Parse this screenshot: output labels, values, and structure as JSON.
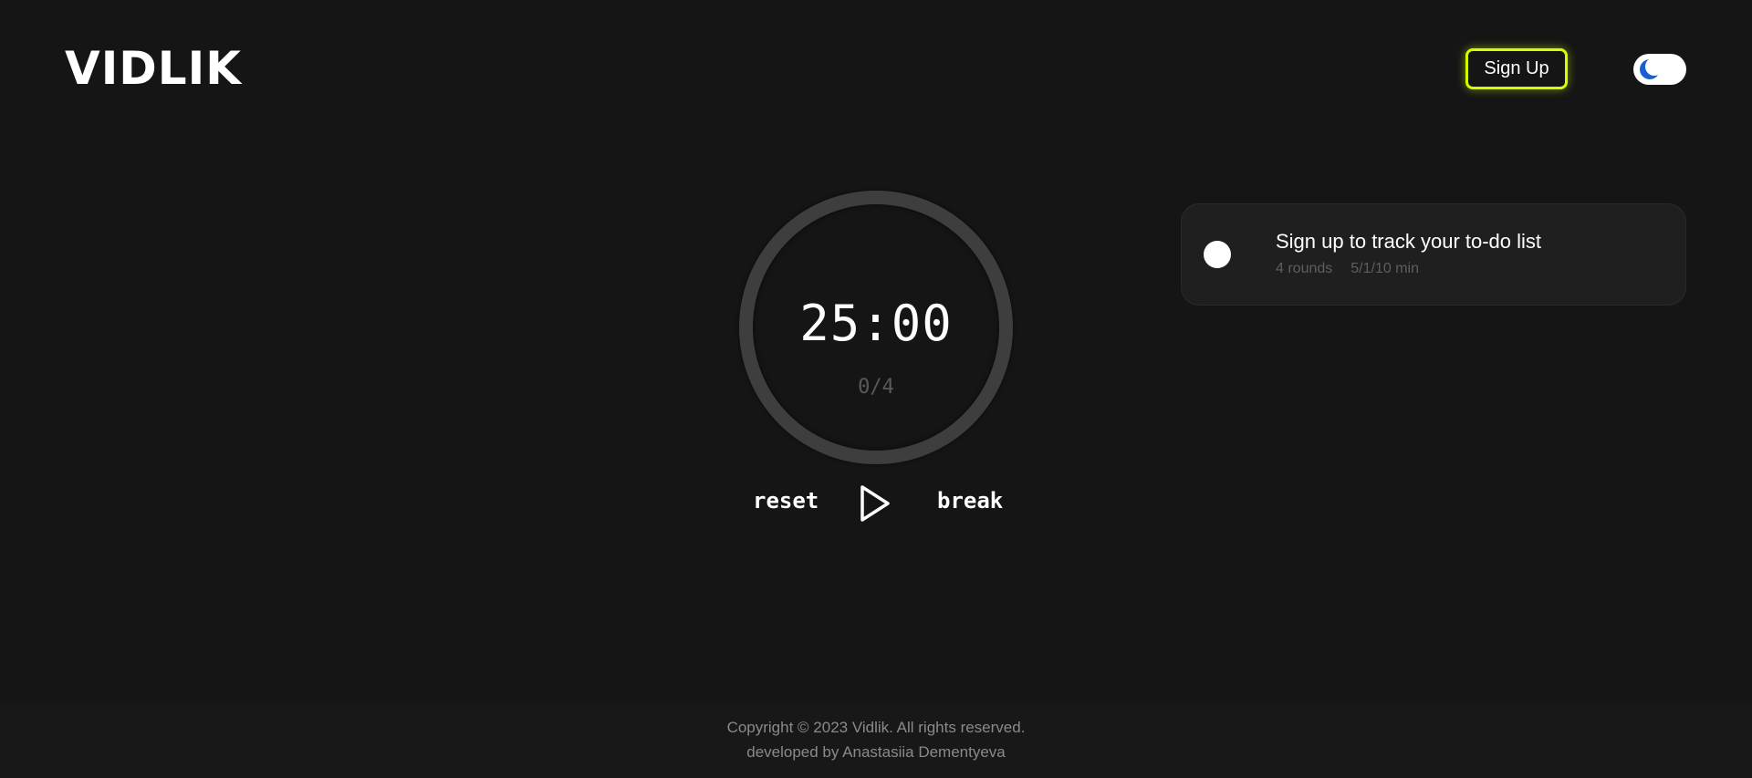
{
  "header": {
    "logo": "VIDLIK",
    "signup_label": "Sign Up",
    "theme_toggle_icon": "moon-icon"
  },
  "timer": {
    "time": "25:00",
    "rounds": "0/4",
    "reset_label": "reset",
    "break_label": "break",
    "play_icon": "play-icon"
  },
  "task_card": {
    "title": "Sign up to track your to-do list",
    "rounds": "4 rounds",
    "durations": "5/1/10 min"
  },
  "footer": {
    "copyright": "Copyright © 2023 Vidlik. All rights reserved.",
    "developer": "developed by Anastasiia Dementyeva"
  },
  "colors": {
    "background": "#151515",
    "accent": "#d4ff00",
    "toggle_moon": "#1a5fd0",
    "ring": "#3e3e3e"
  }
}
